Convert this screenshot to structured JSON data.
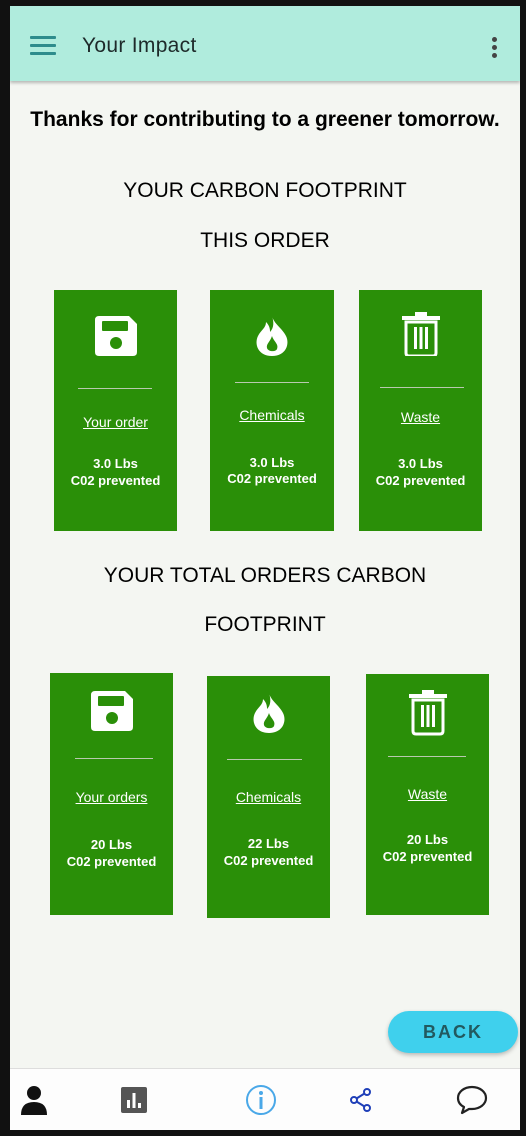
{
  "app_bar": {
    "title": "Your Impact"
  },
  "thanks_text": "Thanks for contributing to a greener tomorrow.",
  "section_this_order": {
    "heading_line1": "YOUR CARBON FOOTPRINT",
    "heading_line2": "THIS ORDER",
    "cards": [
      {
        "icon": "floppy-disk-icon",
        "label": "Your order",
        "amount": "3.0 Lbs",
        "unit": "C02 prevented"
      },
      {
        "icon": "flame-icon",
        "label": "Chemicals",
        "amount": "3.0 Lbs",
        "unit": "C02 prevented"
      },
      {
        "icon": "trash-icon",
        "label": "Waste",
        "amount": "3.0 Lbs",
        "unit": "C02 prevented"
      }
    ]
  },
  "section_total": {
    "heading_line1": "YOUR TOTAL ORDERS CARBON",
    "heading_line2": "FOOTPRINT",
    "cards": [
      {
        "icon": "floppy-disk-icon",
        "label": "Your orders",
        "amount": "20 Lbs",
        "unit": "C02 prevented"
      },
      {
        "icon": "flame-icon",
        "label": "Chemicals",
        "amount": "22 Lbs",
        "unit": "C02 prevented"
      },
      {
        "icon": "trash-icon",
        "label": "Waste",
        "amount": "20 Lbs",
        "unit": "C02 prevented"
      }
    ]
  },
  "back_button": {
    "label": "BACK"
  },
  "bottom_nav": [
    {
      "icon": "person-icon",
      "color": "#111111"
    },
    {
      "icon": "bar-chart-icon",
      "color": "#555555"
    },
    {
      "icon": "info-icon",
      "color": "#4aa8e8"
    },
    {
      "icon": "share-icon",
      "color": "#1f3fb8"
    },
    {
      "icon": "chat-bubble-icon",
      "color": "#222222"
    }
  ],
  "colors": {
    "app_bar": "#b0ecdd",
    "card": "#2a8f08",
    "back_button": "#3fd0ed",
    "background": "#f4f6f2"
  }
}
